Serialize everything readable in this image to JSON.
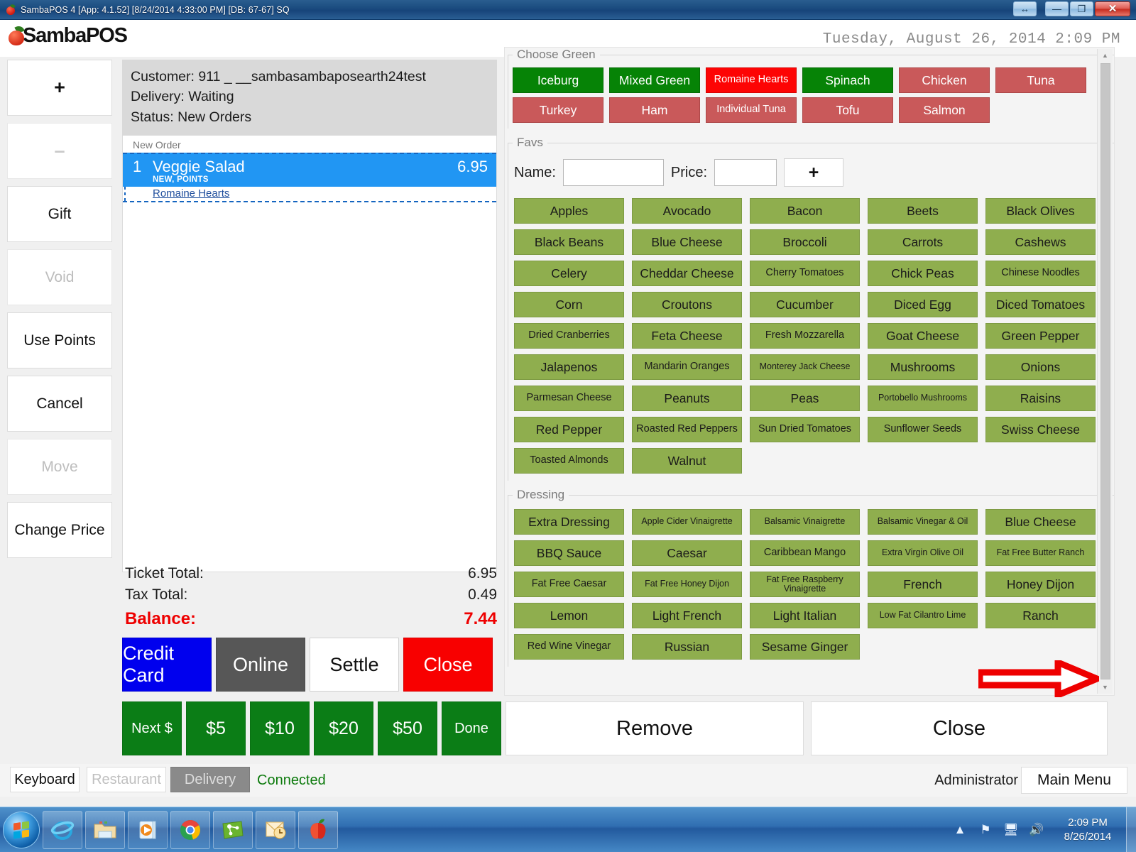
{
  "window": {
    "title": "SambaPOS 4 [App: 4.1.52] [8/24/2014 4:33:00 PM] [DB: 67-67] SQ",
    "icon": "apple-icon",
    "controls": {
      "resize": "↔",
      "minimize": "—",
      "restore": "❐",
      "close": "✕"
    }
  },
  "header": {
    "brand": "SambaPOS",
    "datetime": "Tuesday, August 26, 2014 2:09 PM"
  },
  "commands": [
    {
      "label": "+",
      "enabled": true,
      "name": "increase-quantity-button"
    },
    {
      "label": "–",
      "enabled": false,
      "name": "decrease-quantity-button"
    },
    {
      "label": "Gift",
      "enabled": true,
      "name": "gift-button"
    },
    {
      "label": "Void",
      "enabled": false,
      "name": "void-button"
    },
    {
      "label": "Use Points",
      "enabled": true,
      "name": "use-points-button"
    },
    {
      "label": "Cancel",
      "enabled": true,
      "name": "cancel-button"
    },
    {
      "label": "Move",
      "enabled": false,
      "name": "move-button"
    },
    {
      "label": "Change Price",
      "enabled": true,
      "name": "change-price-button"
    }
  ],
  "ticket": {
    "customer_line": "Customer: 911  _ __sambasambaposearth24test",
    "delivery_line": "Delivery: Waiting",
    "status_line": "Status: New Orders",
    "group_header": "New Order",
    "order": {
      "quantity": "1",
      "name": "Veggie Salad",
      "price": "6.95",
      "tags": "NEW, POINTS",
      "modifier": "Romaine Hearts"
    },
    "totals": [
      {
        "label": "Ticket Total:",
        "value": "6.95"
      },
      {
        "label": "Tax Total:",
        "value": "0.49"
      }
    ],
    "balance": {
      "label": "Balance:",
      "value": "7.44",
      "color": "#ee0000"
    }
  },
  "payment_buttons": [
    {
      "label": "Credit Card",
      "color": "#0000ee",
      "name": "credit-card-button"
    },
    {
      "label": "Online",
      "color": "#575757",
      "name": "online-button"
    },
    {
      "label": "Settle",
      "color": "#ffffff",
      "name": "settle-button"
    },
    {
      "label": "Close",
      "color": "#f80000",
      "name": "close-ticket-button"
    }
  ],
  "tender_buttons": [
    {
      "label": "Next $",
      "name": "next-dollar-button"
    },
    {
      "label": "$5",
      "name": "tender-5-button"
    },
    {
      "label": "$10",
      "name": "tender-10-button"
    },
    {
      "label": "$20",
      "name": "tender-20-button"
    },
    {
      "label": "$50",
      "name": "tender-50-button"
    },
    {
      "label": "Done",
      "name": "done-button"
    }
  ],
  "menu": {
    "choose_green": {
      "legend": "Choose Green",
      "items": [
        {
          "label": "Iceburg",
          "style": "green-dark"
        },
        {
          "label": "Mixed Green",
          "style": "green-dark"
        },
        {
          "label": "Romaine Hearts",
          "style": "red-bright"
        },
        {
          "label": "Spinach",
          "style": "green-dark"
        },
        {
          "label": "Chicken",
          "style": "red-muted"
        },
        {
          "label": "Tuna",
          "style": "red-muted"
        },
        {
          "label": "Turkey",
          "style": "red-muted"
        },
        {
          "label": "Ham",
          "style": "red-muted"
        },
        {
          "label": "Individual Tuna",
          "style": "red-muted"
        },
        {
          "label": "Tofu",
          "style": "red-muted"
        },
        {
          "label": "Salmon",
          "style": "red-muted"
        }
      ]
    },
    "favs": {
      "legend": "Favs",
      "name_label": "Name:",
      "name_value": "",
      "name_placeholder": "",
      "price_label": "Price:",
      "price_value": "",
      "price_placeholder": "",
      "add_label": "+",
      "items": [
        "Apples",
        "Avocado",
        "Bacon",
        "Beets",
        "Black Olives",
        "Black Beans",
        "Blue Cheese",
        "Broccoli",
        "Carrots",
        "Cashews",
        "Celery",
        "Cheddar Cheese",
        "Cherry Tomatoes",
        "Chick Peas",
        "Chinese Noodles",
        "Corn",
        "Croutons",
        "Cucumber",
        "Diced Egg",
        "Diced Tomatoes",
        "Dried Cranberries",
        "Feta Cheese",
        "Fresh Mozzarella",
        "Goat Cheese",
        "Green Pepper",
        "Jalapenos",
        "Mandarin Oranges",
        "Monterey Jack Cheese",
        "Mushrooms",
        "Onions",
        "Parmesan Cheese",
        "Peanuts",
        "Peas",
        "Portobello Mushrooms",
        "Raisins",
        "Red Pepper",
        "Roasted Red Peppers",
        "Sun Dried Tomatoes",
        "Sunflower Seeds",
        "Swiss Cheese",
        "Toasted Almonds",
        "Walnut"
      ]
    },
    "dressing": {
      "legend": "Dressing",
      "items": [
        "Extra Dressing",
        "Apple Cider Vinaigrette",
        "Balsamic Vinaigrette",
        "Balsamic Vinegar & Oil",
        "Blue Cheese",
        "BBQ Sauce",
        "Caesar",
        "Caribbean Mango",
        "Extra Virgin Olive Oil",
        "Fat Free Butter Ranch",
        "Fat Free Caesar",
        "Fat Free Honey Dijon",
        "Fat Free Raspberry Vinaigrette",
        "French",
        "Honey Dijon",
        "Lemon",
        "Light French",
        "Light Italian",
        "Low Fat Cilantro Lime",
        "Ranch",
        "Red Wine Vinegar",
        "Russian",
        "Sesame Ginger"
      ]
    },
    "footer_buttons": [
      {
        "label": "Remove",
        "name": "remove-button"
      },
      {
        "label": "Close",
        "name": "close-panel-button"
      }
    ]
  },
  "statusbar": {
    "keyboard": "Keyboard",
    "restaurant": "Restaurant",
    "delivery": "Delivery",
    "connected": "Connected",
    "user": "Administrator",
    "main_menu": "Main Menu"
  },
  "taskbar": {
    "clock_time": "2:09 PM",
    "clock_date": "8/26/2014",
    "items": [
      "internet-explorer-icon",
      "file-explorer-icon",
      "media-player-icon",
      "google-chrome-icon",
      "green-app-icon",
      "outlook-icon",
      "sambapos-apple-icon"
    ],
    "tray": [
      "show-hidden-icons-icon",
      "network-flag-icon",
      "action-center-icon",
      "volume-icon"
    ]
  },
  "annotation": {
    "type": "red-arrow",
    "points_to": "vertical-scrollbar"
  }
}
